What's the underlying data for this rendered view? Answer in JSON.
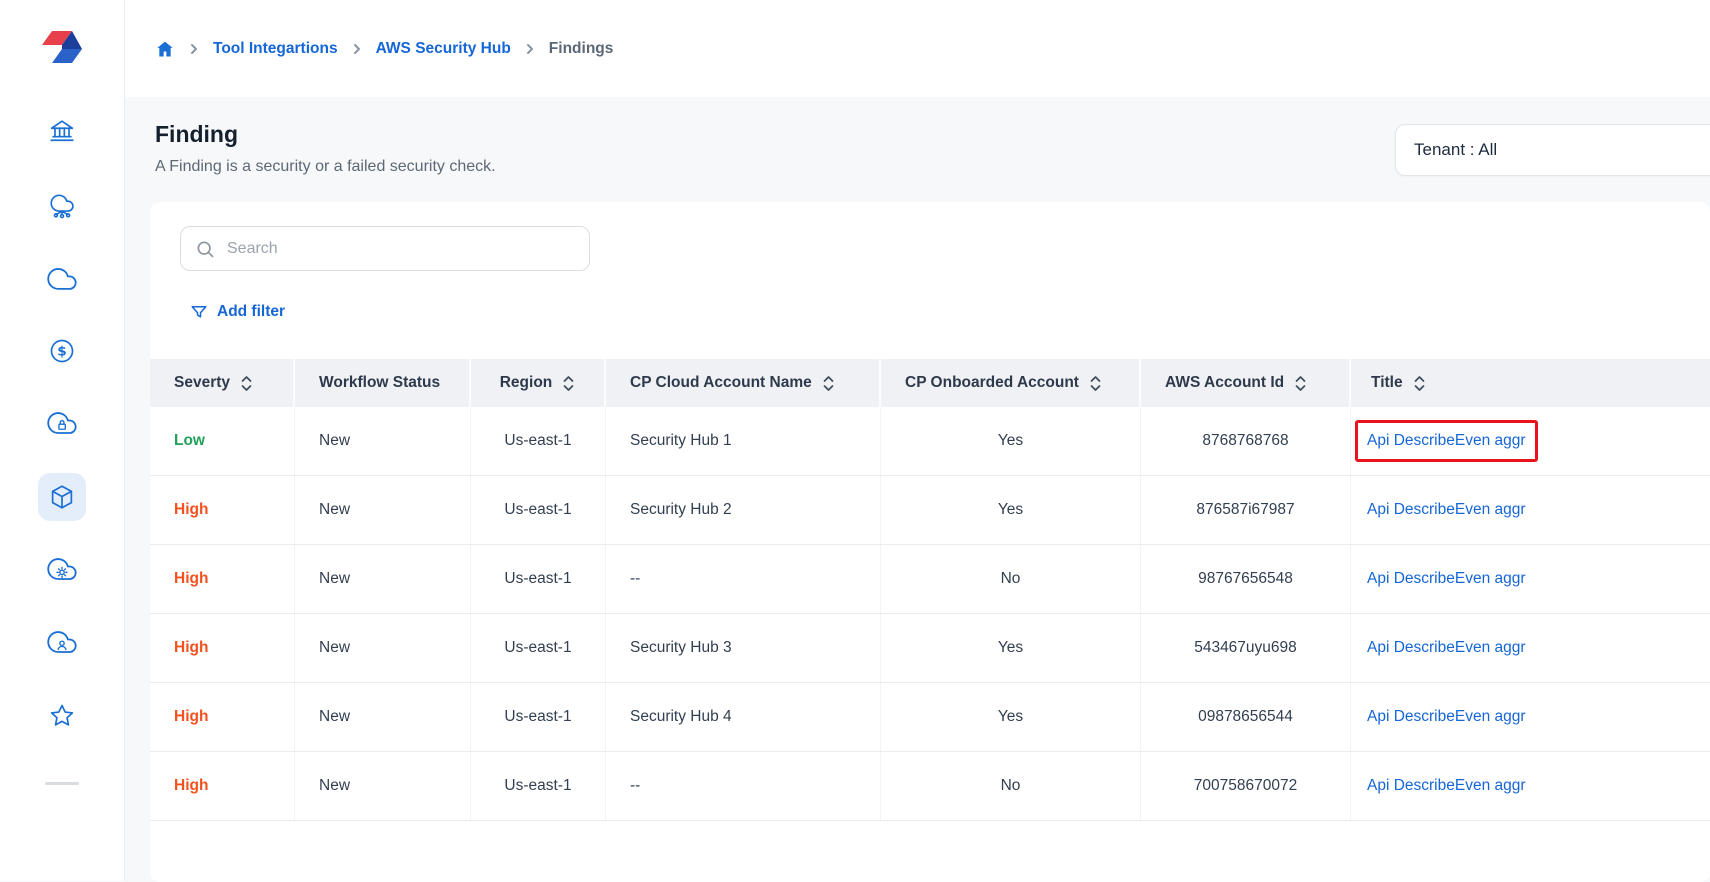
{
  "breadcrumb": {
    "items": [
      "Tool Integartions",
      "AWS Security Hub",
      "Findings"
    ]
  },
  "page": {
    "title": "Finding",
    "subtitle": "A Finding is a security or a failed security check.",
    "tenant_filter": "Tenant : All"
  },
  "toolbar": {
    "search_placeholder": "Search",
    "add_filter_label": "Add filter"
  },
  "sidebar": {
    "icons": [
      "app-logo",
      "bank",
      "cloud-network",
      "cloud",
      "dollar",
      "cloud-lock",
      "cube",
      "cloud-gear",
      "cloud-user",
      "star"
    ],
    "active_icon": "cube"
  },
  "table": {
    "columns": [
      {
        "label": "Severty",
        "sortable": true
      },
      {
        "label": "Workflow Status",
        "sortable": false
      },
      {
        "label": "Region",
        "sortable": true
      },
      {
        "label": "CP Cloud Account Name",
        "sortable": true
      },
      {
        "label": "CP Onboarded Account",
        "sortable": true
      },
      {
        "label": "AWS Account Id",
        "sortable": true
      },
      {
        "label": "Title",
        "sortable": true
      }
    ],
    "rows": [
      {
        "severity": "Low",
        "workflow_status": "New",
        "region": "Us-east-1",
        "cp_cloud_account_name": "Security Hub 1",
        "cp_onboarded_account": "Yes",
        "aws_account_id": "8768768768",
        "title": "Api DescribeEven aggr",
        "highlighted": true
      },
      {
        "severity": "High",
        "workflow_status": "New",
        "region": "Us-east-1",
        "cp_cloud_account_name": "Security Hub 2",
        "cp_onboarded_account": "Yes",
        "aws_account_id": "876587i67987",
        "title": "Api DescribeEven aggr",
        "highlighted": false
      },
      {
        "severity": "High",
        "workflow_status": "New",
        "region": "Us-east-1",
        "cp_cloud_account_name": "--",
        "cp_onboarded_account": "No",
        "aws_account_id": "98767656548",
        "title": "Api DescribeEven aggr",
        "highlighted": false
      },
      {
        "severity": "High",
        "workflow_status": "New",
        "region": "Us-east-1",
        "cp_cloud_account_name": "Security Hub 3",
        "cp_onboarded_account": "Yes",
        "aws_account_id": "543467uyu698",
        "title": "Api DescribeEven aggr",
        "highlighted": false
      },
      {
        "severity": "High",
        "workflow_status": "New",
        "region": "Us-east-1",
        "cp_cloud_account_name": "Security Hub 4",
        "cp_onboarded_account": "Yes",
        "aws_account_id": "09878656544",
        "title": "Api DescribeEven aggr",
        "highlighted": false
      },
      {
        "severity": "High",
        "workflow_status": "New",
        "region": "Us-east-1",
        "cp_cloud_account_name": "--",
        "cp_onboarded_account": "No",
        "aws_account_id": "700758670072",
        "title": "Api DescribeEven aggr",
        "highlighted": false
      }
    ]
  },
  "colors": {
    "accent_blue": "#1a6fd4",
    "link_blue": "#1566d6",
    "severity_low_green": "#21a05a",
    "severity_high_orange": "#f4511e",
    "annotation_red": "#e8131c",
    "table_header_bg": "#eff1f4"
  }
}
